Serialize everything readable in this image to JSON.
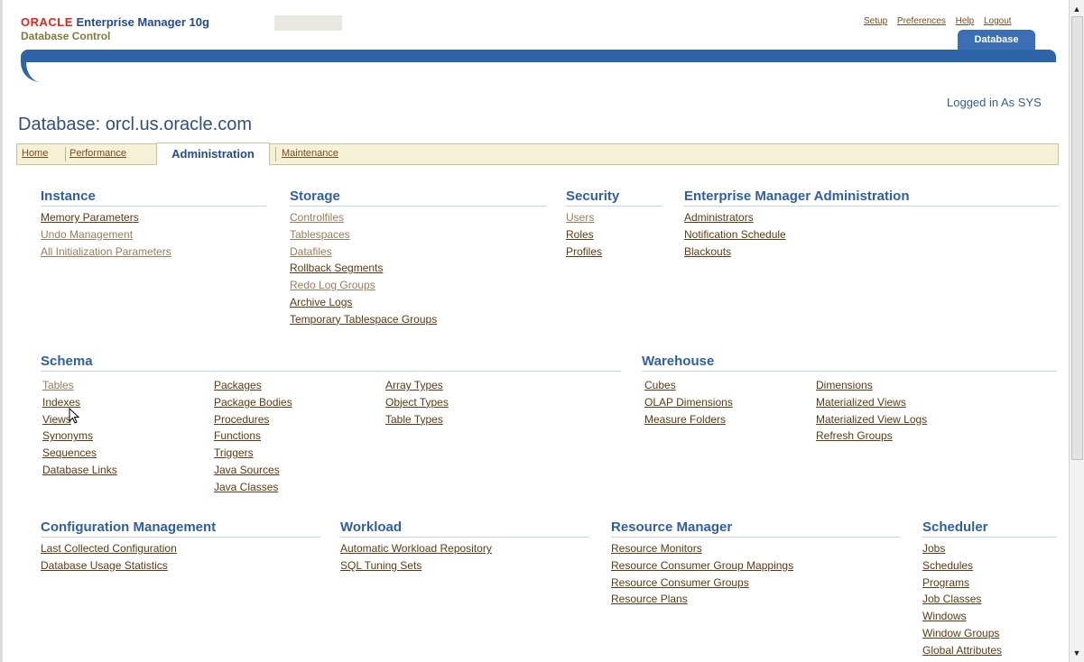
{
  "brand": {
    "oracle": "ORACLE",
    "product": "Enterprise Manager 10g",
    "subtitle": "Database Control"
  },
  "global_links": [
    "Setup",
    "Preferences",
    "Help",
    "Logout"
  ],
  "target_tab": "Database",
  "logged_in": "Logged in As SYS",
  "page_title": "Database: orcl.us.oracle.com",
  "tabs": {
    "home": "Home",
    "performance": "Performance",
    "administration": "Administration",
    "maintenance": "Maintenance",
    "active": "Administration"
  },
  "sections": {
    "instance": {
      "title": "Instance",
      "links": [
        "Memory Parameters",
        "Undo Management",
        "All Initialization Parameters"
      ]
    },
    "storage": {
      "title": "Storage",
      "links": [
        "Controlfiles",
        "Tablespaces",
        "Datafiles",
        "Rollback Segments",
        "Redo Log Groups",
        "Archive Logs",
        "Temporary Tablespace Groups"
      ]
    },
    "security": {
      "title": "Security",
      "links": [
        "Users",
        "Roles",
        "Profiles"
      ]
    },
    "em_admin": {
      "title": "Enterprise Manager Administration",
      "links": [
        "Administrators",
        "Notification Schedule",
        "Blackouts"
      ]
    },
    "schema": {
      "title": "Schema",
      "col1": [
        "Tables",
        "Indexes",
        "Views",
        "Synonyms",
        "Sequences",
        "Database Links"
      ],
      "col2": [
        "Packages",
        "Package Bodies",
        "Procedures",
        "Functions",
        "Triggers",
        "Java Sources",
        "Java Classes"
      ],
      "col3": [
        "Array Types",
        "Object Types",
        "Table Types"
      ]
    },
    "warehouse": {
      "title": "Warehouse",
      "col1": [
        "Cubes",
        "OLAP Dimensions",
        "Measure Folders"
      ],
      "col2": [
        "Dimensions",
        "Materialized Views",
        "Materialized View Logs",
        "Refresh Groups"
      ]
    },
    "config_mgmt": {
      "title": "Configuration Management",
      "links": [
        "Last Collected Configuration",
        "Database Usage Statistics"
      ]
    },
    "workload": {
      "title": "Workload",
      "links": [
        "Automatic Workload Repository",
        "SQL Tuning Sets"
      ]
    },
    "resource_mgr": {
      "title": "Resource Manager",
      "links": [
        "Resource Monitors",
        "Resource Consumer Group Mappings",
        "Resource Consumer Groups",
        "Resource Plans"
      ]
    },
    "scheduler": {
      "title": "Scheduler",
      "links": [
        "Jobs",
        "Schedules",
        "Programs",
        "Job Classes",
        "Windows",
        "Window Groups",
        "Global Attributes"
      ]
    }
  },
  "colors": {
    "header_blue": "#2e65a9",
    "section_heading": "#2f5f9f",
    "visited_link": "#5d3a12",
    "unvisited_link": "#9a7b5a",
    "tab_bar": "#f5f1d6"
  }
}
